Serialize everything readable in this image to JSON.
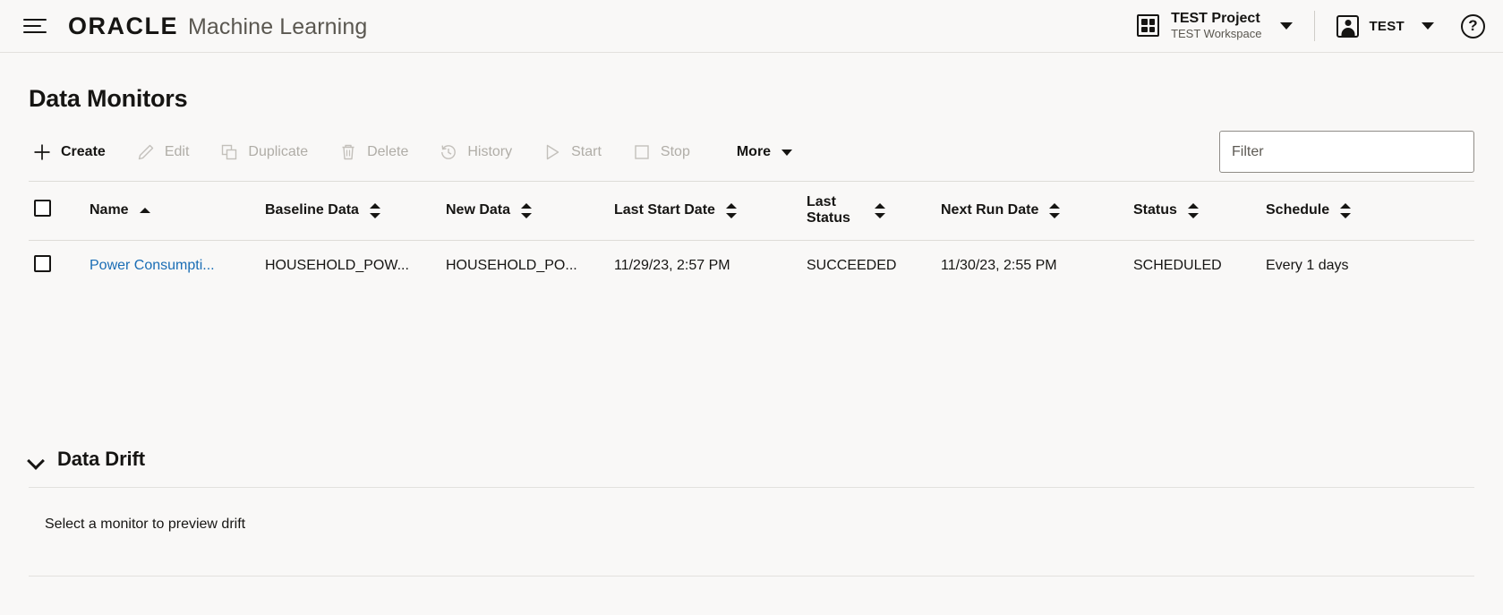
{
  "header": {
    "menu_icon": "hamburger-icon",
    "brand_oracle": "ORACLE",
    "brand_product": "Machine Learning",
    "project": {
      "icon": "grid-icon",
      "name": "TEST Project",
      "workspace": "TEST Workspace",
      "caret": "chevron-down-icon"
    },
    "user": {
      "icon": "user-badge-icon",
      "name": "TEST",
      "caret": "chevron-down-icon"
    },
    "help": {
      "icon": "help-icon",
      "glyph": "?"
    }
  },
  "page": {
    "title": "Data Monitors"
  },
  "toolbar": {
    "buttons": [
      {
        "label": "Create",
        "icon": "plus-icon",
        "enabled": true
      },
      {
        "label": "Edit",
        "icon": "pencil-icon",
        "enabled": false
      },
      {
        "label": "Duplicate",
        "icon": "copy-icon",
        "enabled": false
      },
      {
        "label": "Delete",
        "icon": "trash-icon",
        "enabled": false
      },
      {
        "label": "History",
        "icon": "history-icon",
        "enabled": false
      },
      {
        "label": "Start",
        "icon": "play-icon",
        "enabled": false
      },
      {
        "label": "Stop",
        "icon": "stop-icon",
        "enabled": false
      }
    ],
    "more_label": "More",
    "more_caret": "caret-down-icon"
  },
  "filter": {
    "value": "",
    "placeholder": "Filter"
  },
  "table": {
    "select_all_checkbox": "checkbox",
    "columns": [
      {
        "label": "Name",
        "sort": "asc",
        "key": "c-name"
      },
      {
        "label": "Baseline Data",
        "sort": "none",
        "key": "c-baseline"
      },
      {
        "label": "New Data",
        "sort": "none",
        "key": "c-newdata"
      },
      {
        "label": "Last Start Date",
        "sort": "none",
        "key": "c-laststart"
      },
      {
        "label": "Last Status",
        "sort": "none",
        "key": "c-laststatus"
      },
      {
        "label": "Next Run Date",
        "sort": "none",
        "key": "c-nextrun"
      },
      {
        "label": "Status",
        "sort": "none",
        "key": "c-status"
      },
      {
        "label": "Schedule",
        "sort": "none",
        "key": "c-schedule"
      }
    ],
    "rows": [
      {
        "name": "Power Consumpti...",
        "baseline_data": "HOUSEHOLD_POW...",
        "new_data": "HOUSEHOLD_PO...",
        "last_start_date": "11/29/23, 2:57 PM",
        "last_status": "SUCCEEDED",
        "next_run_date": "11/30/23, 2:55 PM",
        "status": "SCHEDULED",
        "schedule": "Every 1 days"
      }
    ]
  },
  "data_drift": {
    "expand_icon": "chevron-down-icon",
    "title": "Data Drift",
    "empty_message": "Select a monitor to preview drift"
  },
  "colors": {
    "page_background": "#f9f8f7",
    "text": "#161513",
    "disabled_text": "#b0ada7",
    "link": "#1a6db5",
    "border": "#e3e1de"
  }
}
